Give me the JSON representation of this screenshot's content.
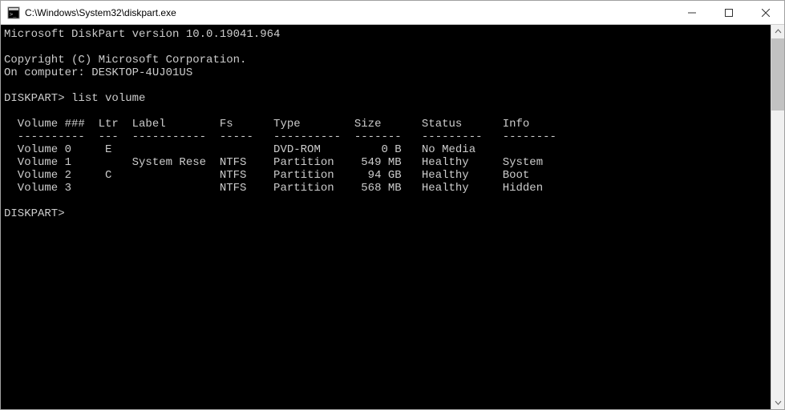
{
  "window": {
    "title": "C:\\Windows\\System32\\diskpart.exe"
  },
  "console": {
    "version_line": "Microsoft DiskPart version 10.0.19041.964",
    "copyright_line": "Copyright (C) Microsoft Corporation.",
    "computer_line": "On computer: DESKTOP-4UJ01US",
    "prompt": "DISKPART>",
    "command": "list volume",
    "headers": {
      "volume": "Volume ###",
      "ltr": "Ltr",
      "label": "Label",
      "fs": "Fs",
      "type": "Type",
      "size": "Size",
      "status": "Status",
      "info": "Info"
    },
    "dashes": {
      "volume": "----------",
      "ltr": "---",
      "label": "-----------",
      "fs": "-----",
      "type": "----------",
      "size": "-------",
      "status": "---------",
      "info": "--------"
    },
    "rows": [
      {
        "volume": "Volume 0",
        "ltr": "E",
        "label": "",
        "fs": "",
        "type": "DVD-ROM",
        "size": "0 B",
        "status": "No Media",
        "info": ""
      },
      {
        "volume": "Volume 1",
        "ltr": "",
        "label": "System Rese",
        "fs": "NTFS",
        "type": "Partition",
        "size": "549 MB",
        "status": "Healthy",
        "info": "System"
      },
      {
        "volume": "Volume 2",
        "ltr": "C",
        "label": "",
        "fs": "NTFS",
        "type": "Partition",
        "size": "94 GB",
        "status": "Healthy",
        "info": "Boot"
      },
      {
        "volume": "Volume 3",
        "ltr": "",
        "label": "",
        "fs": "NTFS",
        "type": "Partition",
        "size": "568 MB",
        "status": "Healthy",
        "info": "Hidden"
      }
    ]
  }
}
